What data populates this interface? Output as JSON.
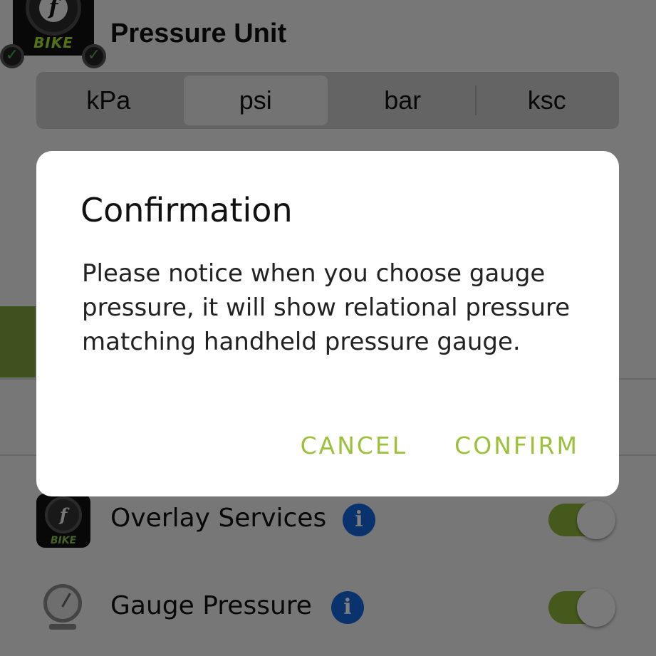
{
  "header": {
    "title": "Pressure Unit",
    "app_icon_brand": "BIKE",
    "app_icon_letter": "f"
  },
  "pressure_units": {
    "options": [
      "kPa",
      "psi",
      "bar",
      "ksc"
    ],
    "selected": "psi"
  },
  "settings": {
    "overlay_services": {
      "label": "Overlay Services",
      "info": "i",
      "enabled": true,
      "icon": "bike-app-icon"
    },
    "gauge_pressure": {
      "label": "Gauge Pressure",
      "info": "i",
      "enabled": true,
      "icon": "gauge-icon"
    }
  },
  "dialog": {
    "title": "Confirmation",
    "message": "Please notice when you choose gauge pressure, it will show relational pressure matching handheld pressure gauge.",
    "cancel_label": "CANCEL",
    "confirm_label": "CONFIRM"
  },
  "colors": {
    "accent": "#9bc13b",
    "toggle_on": "#8db33a",
    "info_blue": "#1464d8",
    "scrim": "#000000"
  }
}
